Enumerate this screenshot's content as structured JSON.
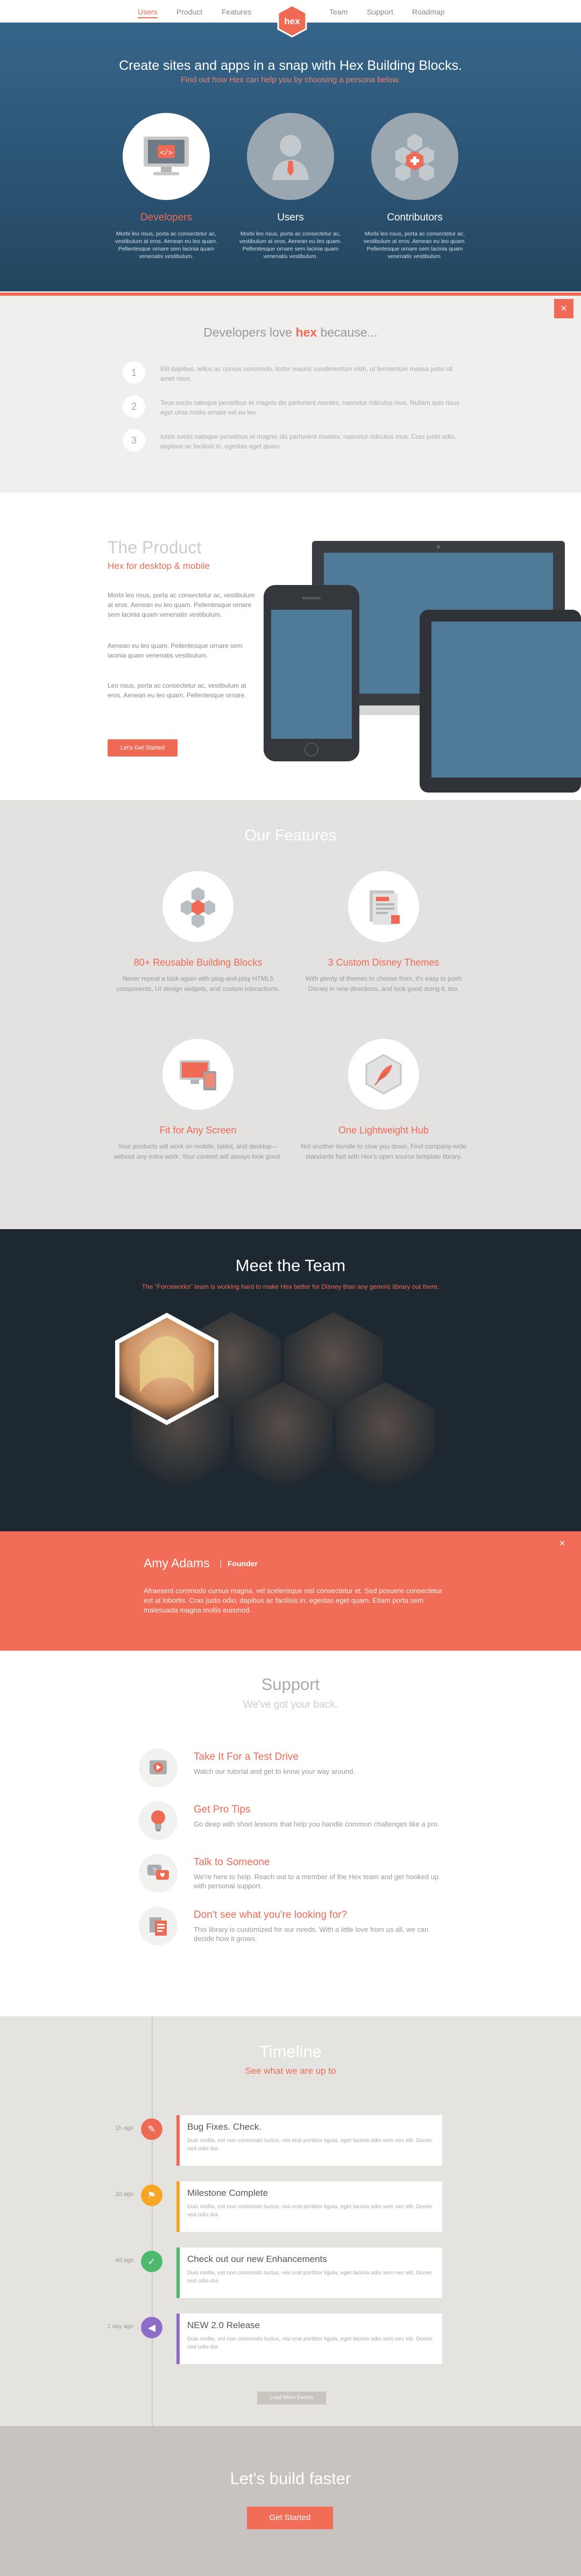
{
  "nav": {
    "items": [
      "Users",
      "Product",
      "Features",
      "Team",
      "Support",
      "Roadmap"
    ],
    "logo": "hex"
  },
  "hero": {
    "title": "Create sites and apps in a snap with Hex Building Blocks.",
    "subtitle": "Find out how Hex can help you by choosing a persona below.",
    "personas": [
      {
        "label": "Developers",
        "desc": "Morbi leo risus, porta ac consectetur ac, vestibulum at eros. Aenean eu leo quam. Pellentesque ornare sem lacinia quam venenatis vestibulum.",
        "icon": "monitor-code-icon"
      },
      {
        "label": "Users",
        "desc": "Morbi leo risus, porta ac consectetur ac, vestibulum at eros. Aenean eu leo quam. Pellentesque ornare sem lacinia quam venenatis vestibulum.",
        "icon": "user-icon"
      },
      {
        "label": "Contributors",
        "desc": "Morbi leo risus, porta ac consectetur ac, vestibulum at eros. Aenean eu leo quam. Pellentesque ornare sem lacinia quam venenatis vestibulum.",
        "icon": "hex-plus-icon"
      }
    ]
  },
  "reasons": {
    "close": "×",
    "title_pre": "Developers love ",
    "title_highlight": "hex",
    "title_post": " because...",
    "items": [
      {
        "num": "1",
        "text": "Elit dapibus, tellus ac cursus commodo, tortor mauris condimentum nibh, ut fermentum massa justo sit amet risus."
      },
      {
        "num": "2",
        "text": "Teus sociis natoque penatibus et magnis dis parturient montes, nascetur ridiculus mus. Nullam quis risus eget urna mollis ornare vel eu leo."
      },
      {
        "num": "3",
        "text": "Iuisis sociis natoque penatibus et magnis dis parturient montes, nascetur ridiculus mus. Cras justo odio, dapibus ac facilisis in, egestas eget quam."
      }
    ]
  },
  "product": {
    "title": "The Product",
    "subtitle": "Hex for desktop & mobile",
    "paragraphs": [
      "Morbi leo risus, porta ac consectetur ac, vestibulum at eros. Aenean eu leo quam. Pellentesque ornare sem lacinia quam venenatis vestibulum.",
      "Aenean eu leo quam. Pellentesque ornare sem lacinia quam venenatis vestibulum.",
      "Leo risus, porta ac consectetur ac, vestibulum at eros. Aenean eu leo quam. Pellentesque ornare."
    ],
    "button": "Let's Get Started"
  },
  "features": {
    "title": "Our Features",
    "items": [
      {
        "title": "80+ Reusable Building Blocks",
        "desc": "Never repeat a task again with plug-and-play HTML5 components, UI design widgets, and custom interactions.",
        "icon": "blocks-icon"
      },
      {
        "title": "3 Custom Disney Themes",
        "desc": "With plenty of themes to choose from, it's easy to push Disney in new directions, and look good doing it, too.",
        "icon": "themes-icon"
      },
      {
        "title": "Fit for Any Screen",
        "desc": "Your products will work on mobile, tablet, and desktop—without any extra work. Your content will always look good.",
        "icon": "devices-icon"
      },
      {
        "title": "One Lightweight Hub",
        "desc": "Not another bundle to slow you down. Find company-wide standards fast with Hex's open source template library.",
        "icon": "feather-hex-icon"
      }
    ]
  },
  "team": {
    "title": "Meet the Team",
    "subtitle": "The \"Forceworks\" team is working hard to make Hex better for Disney than any generic library out there."
  },
  "member": {
    "close": "×",
    "name": "Amy Adams",
    "role": "Founder",
    "bio": "Afraesent commodo cursus magna, vel scelerisque nisl consectetur et. Sed posuere consectetur est at lobortis. Cras justo odio, dapibus ac facilisis in, egestas eget quam. Etiam porta sem malesuada magna mollis euismod."
  },
  "support": {
    "title": "Support",
    "subtitle": "We've got your back.",
    "items": [
      {
        "title": "Take It For a Test Drive",
        "desc": "Watch our tutorial and get to know your way around.",
        "icon": "play-icon"
      },
      {
        "title": "Get Pro Tips",
        "desc": "Go deep with short lessons that help you handle common challenges like a pro.",
        "icon": "lightbulb-icon"
      },
      {
        "title": "Talk to Someone",
        "desc": "We're here to help. Reach out to a member of the Hex team and get hooked up with personal support.",
        "icon": "chat-icon"
      },
      {
        "title": "Don't see what you're looking for?",
        "desc": "This library is customized for our needs. With a little love from us all, we can decide how it grows.",
        "icon": "documents-icon"
      }
    ]
  },
  "timeline": {
    "title": "Timeline",
    "subtitle": "See what we are up to",
    "items": [
      {
        "date": "1h ago",
        "title": "Bug Fixes. Check.",
        "desc": "Duis mollis, est non commodo luctus, nisi erat porttitor ligula, eget lacinia odio sem nec elit. Donec sed odio dui.",
        "color": "#ef6a55",
        "icon": "wrench-icon"
      },
      {
        "date": "2d ago",
        "title": "Milestone Complete",
        "desc": "Duis mollis, est non commodo luctus, nisi erat porttitor ligula, eget lacinia odio sem nec elit. Donec sed odio dui.",
        "color": "#f5a623",
        "icon": "flag-icon"
      },
      {
        "date": "4d ago",
        "title": "Check out our new Enhancements",
        "desc": "Duis mollis, est non commodo luctus, nisi erat porttitor ligula, eget lacinia odio sem nec elit. Donec sed odio dui.",
        "color": "#4cba6a",
        "icon": "check-icon"
      },
      {
        "date": "1 day ago",
        "title": "NEW 2.0 Release",
        "desc": "Duis mollis, est non commodo luctus, nisi erat porttitor ligula, eget lacinia odio sem nec elit. Donec sed odio dui.",
        "color": "#8e6cc9",
        "icon": "megaphone-icon"
      }
    ],
    "load_more": "Load More Events"
  },
  "cta": {
    "title": "Let's build faster",
    "button": "Get Started"
  },
  "colors": {
    "accent": "#ef6a55",
    "hero_blue": "#2b5474",
    "team_dark": "#1e2830"
  }
}
